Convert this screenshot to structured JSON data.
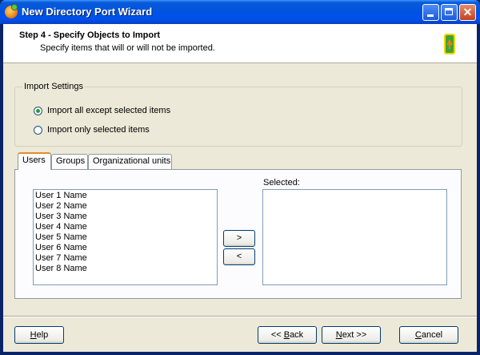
{
  "window": {
    "title": "New Directory Port Wizard"
  },
  "header": {
    "step_title": "Step 4 - Specify Objects to Import",
    "step_subtitle": "Specify items that will or will not be imported."
  },
  "import_settings": {
    "legend": "Import Settings",
    "options": [
      {
        "label": "Import all except selected items",
        "selected": true
      },
      {
        "label": "Import only selected items",
        "selected": false
      }
    ]
  },
  "tabs": [
    {
      "label": "Users",
      "active": true
    },
    {
      "label": "Groups",
      "active": false
    },
    {
      "label": "Organizational units",
      "active": false
    }
  ],
  "available_list": {
    "items": [
      "User 1 Name",
      "User 2 Name",
      "User 3 Name",
      "User 4 Name",
      "User 5 Name",
      "User 6 Name",
      "User 7 Name",
      "User 8 Name"
    ]
  },
  "selected_list": {
    "label": "Selected:",
    "items": []
  },
  "transfer": {
    "add_label": ">",
    "remove_label": "<"
  },
  "footer": {
    "help_pre": "",
    "help_key": "H",
    "help_post": "elp",
    "back_pre": "<< ",
    "back_key": "B",
    "back_post": "ack",
    "next_pre": "",
    "next_key": "N",
    "next_post": "ext >>",
    "cancel_pre": "",
    "cancel_key": "C",
    "cancel_post": "ancel"
  },
  "colors": {
    "title_bar": "#0053e1",
    "dialog_bg": "#ece9d8",
    "tab_highlight": "#e68b2c",
    "radio_dot": "#21a121"
  }
}
